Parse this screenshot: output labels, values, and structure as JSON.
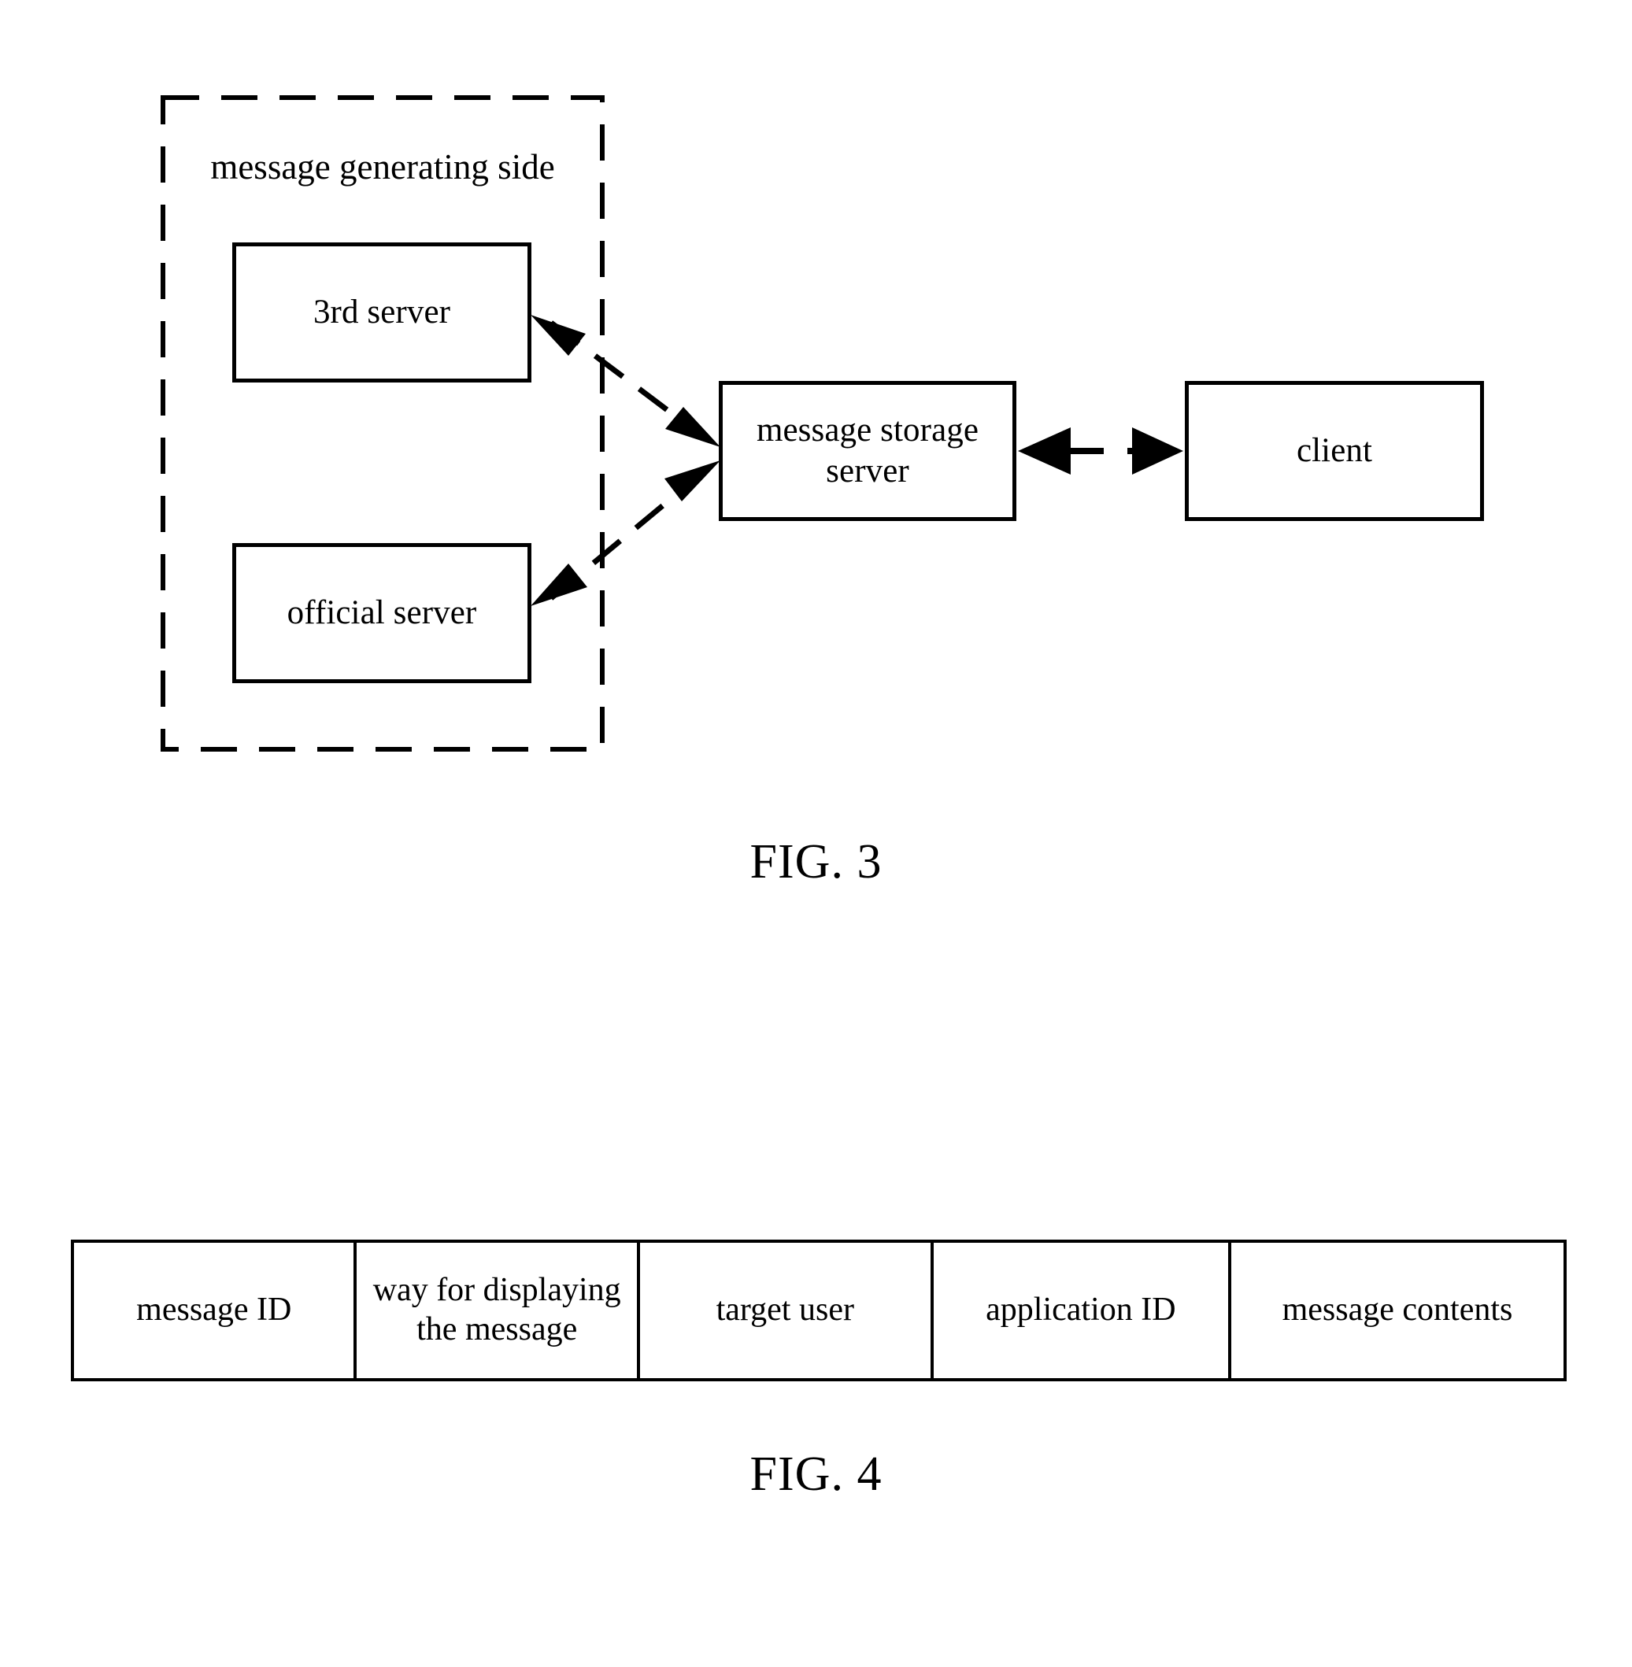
{
  "figures": [
    {
      "id": "fig3",
      "caption": "FIG. 3",
      "group": {
        "label": "message generating side",
        "border_style": "dashed"
      },
      "nodes": [
        {
          "id": "third-server",
          "label": "3rd server"
        },
        {
          "id": "official-server",
          "label": "official server"
        },
        {
          "id": "storage-server",
          "label": "message storage\nserver",
          "line1": "message storage",
          "line2": "server"
        },
        {
          "id": "client",
          "label": "client"
        }
      ],
      "connections": [
        {
          "from": "third-server",
          "to": "storage-server",
          "style": "dashed",
          "arrows": "both"
        },
        {
          "from": "official-server",
          "to": "storage-server",
          "style": "dashed",
          "arrows": "both"
        },
        {
          "from": "storage-server",
          "to": "client",
          "style": "dashed",
          "arrows": "both"
        }
      ]
    },
    {
      "id": "fig4",
      "caption": "FIG. 4",
      "table": {
        "columns": [
          "message ID",
          "way for displaying\nthe message",
          "target user",
          "application ID",
          "message contents"
        ]
      }
    }
  ],
  "fig3": {
    "caption": "FIG. 3",
    "group_label": "message generating side",
    "third_server": "3rd server",
    "official_server": "official server",
    "storage_server_line1": "message storage",
    "storage_server_line2": "server",
    "client": "client"
  },
  "fig4": {
    "caption": "FIG. 4",
    "cells": [
      {
        "line1": "message ID",
        "line2": ""
      },
      {
        "line1": "way for displaying",
        "line2": "the message"
      },
      {
        "line1": "target user",
        "line2": ""
      },
      {
        "line1": "application ID",
        "line2": ""
      },
      {
        "line1": "message contents",
        "line2": ""
      }
    ]
  },
  "colors": {
    "line": "#000000",
    "background": "#ffffff"
  }
}
